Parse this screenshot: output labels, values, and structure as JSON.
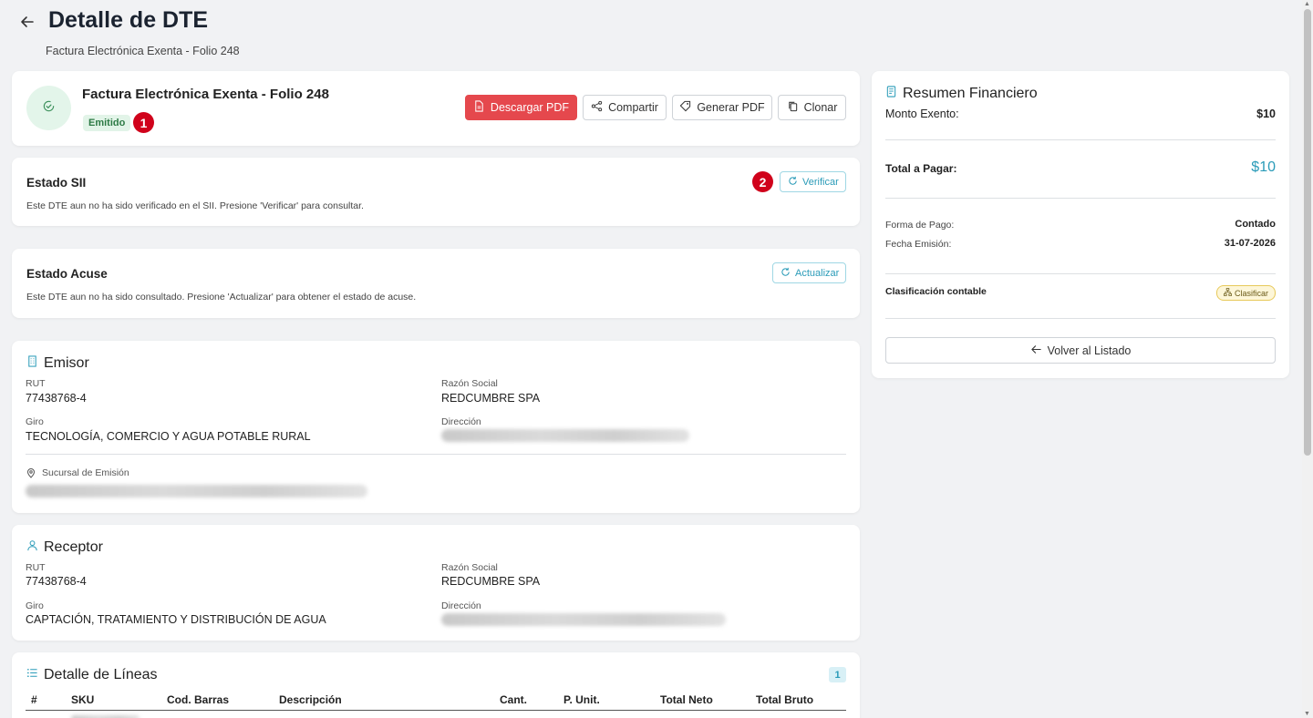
{
  "page": {
    "title": "Detalle de DTE",
    "subtitle": "Factura Electrónica Exenta - Folio 248"
  },
  "header": {
    "doc_title": "Factura Electrónica Exenta - Folio 248",
    "status_badge": "Emitido",
    "marker_1": "1",
    "buttons": {
      "descargar": "Descargar PDF",
      "compartir": "Compartir",
      "generar": "Generar PDF",
      "clonar": "Clonar"
    }
  },
  "sii": {
    "title": "Estado SII",
    "description": "Este DTE aun no ha sido verificado en el SII. Presione 'Verificar' para consultar.",
    "marker_2": "2",
    "button": "Verificar"
  },
  "acuse": {
    "title": "Estado Acuse",
    "description": "Este DTE aun no ha sido consultado. Presione 'Actualizar' para obtener el estado de acuse.",
    "button": "Actualizar"
  },
  "emisor": {
    "title": "Emisor",
    "rut_label": "RUT",
    "rut": "77438768-4",
    "razon_label": "Razón Social",
    "razon": "REDCUMBRE SPA",
    "giro_label": "Giro",
    "giro": "TECNOLOGÍA, COMERCIO Y AGUA POTABLE RURAL",
    "direccion_label": "Dirección",
    "sucursal_label": "Sucursal de Emisión"
  },
  "receptor": {
    "title": "Receptor",
    "rut_label": "RUT",
    "rut": "77438768-4",
    "razon_label": "Razón Social",
    "razon": "REDCUMBRE SPA",
    "giro_label": "Giro",
    "giro": "CAPTACIÓN, TRATAMIENTO Y DISTRIBUCIÓN DE AGUA",
    "direccion_label": "Dirección"
  },
  "lineas": {
    "title": "Detalle de Líneas",
    "count": "1",
    "columns": [
      "#",
      "SKU",
      "Cod. Barras",
      "Descripción",
      "Cant.",
      "P. Unit.",
      "Total Neto",
      "Total Bruto"
    ]
  },
  "resumen": {
    "title": "Resumen Financiero",
    "monto_exento_label": "Monto Exento:",
    "monto_exento": "$10",
    "total_label": "Total a Pagar:",
    "total": "$10",
    "forma_pago_label": "Forma de Pago:",
    "forma_pago": "Contado",
    "fecha_label": "Fecha Emisión:",
    "fecha": "31-07-2026",
    "clasificacion_label": "Clasificación contable",
    "clasificar_badge": "Clasificar",
    "volver_button": "Volver al Listado"
  },
  "colors": {
    "accent": "#2a9bb8",
    "danger": "#e5484d",
    "marker": "#d0021b",
    "success_bg": "#e2f4e8",
    "success_text": "#2d7a45"
  }
}
